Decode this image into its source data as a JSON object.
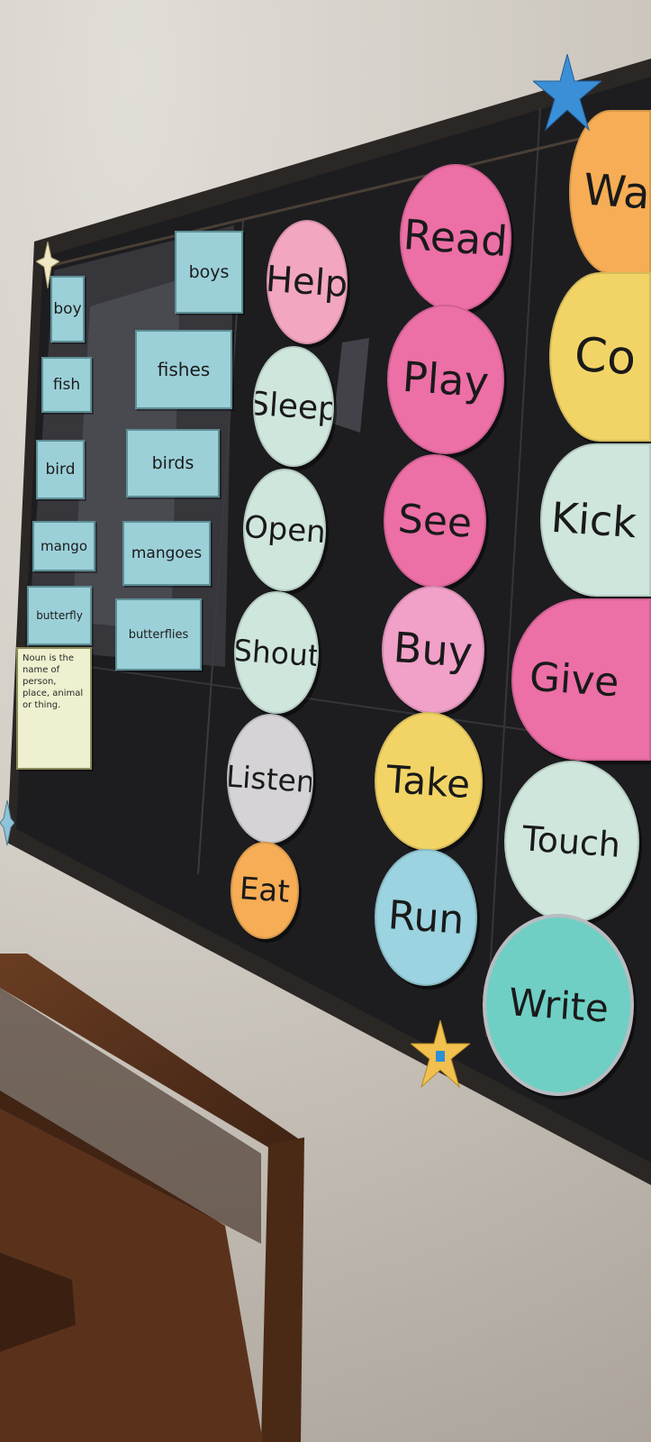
{
  "nouns": {
    "singular": [
      "boy",
      "fish",
      "bird",
      "mango",
      "butterfly"
    ],
    "plural": [
      "boys",
      "fishes",
      "birds",
      "mangoes",
      "butterflies"
    ],
    "definition": "Noun is the name of person, place, animal or thing."
  },
  "verbs": {
    "column1": [
      "Help",
      "Sleep",
      "Open",
      "Shout",
      "Listen",
      "Eat"
    ],
    "column2": [
      "Read",
      "Play",
      "See",
      "Buy",
      "Take",
      "Run"
    ],
    "column3": [
      "Wa",
      "Co",
      "Kick",
      "Give",
      "Touch",
      "Write"
    ]
  },
  "colors": {
    "board": "#1f1f22",
    "noun_card": "#9cd0d8",
    "pink": "#ec6fa6",
    "light_pink": "#f2a6bf",
    "mint": "#cfe6dc",
    "grey": "#d5d3d6",
    "orange": "#f6ad55",
    "yellow": "#f2d466",
    "teal": "#6fcfc4",
    "sky": "#9bd3e0"
  }
}
